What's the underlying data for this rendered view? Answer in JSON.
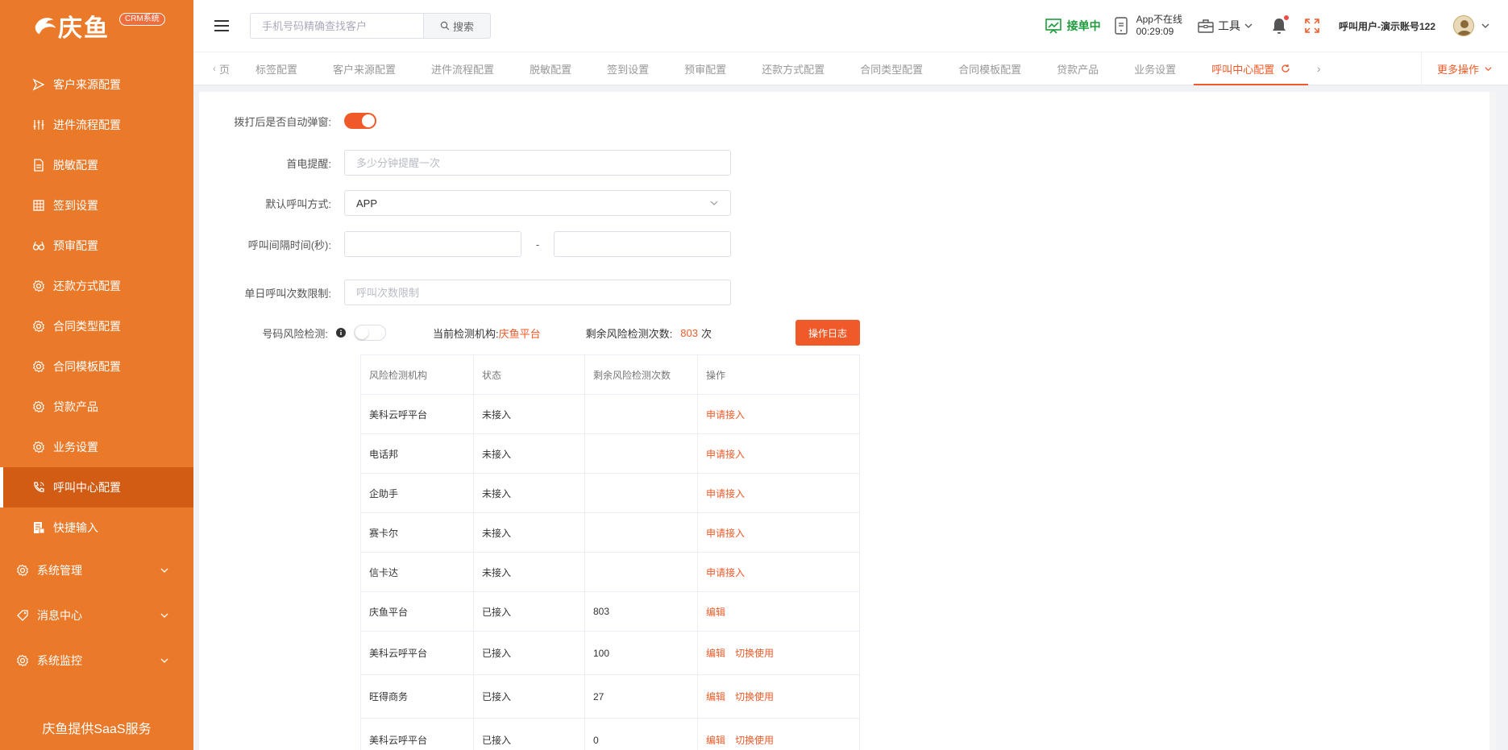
{
  "brand": {
    "logo_text": "庆鱼",
    "badge": "CRM系统",
    "footer": "庆鱼提供SaaS服务"
  },
  "sidebar": {
    "items": [
      {
        "label": "客户来源配置",
        "icon": "send-icon"
      },
      {
        "label": "进件流程配置",
        "icon": "sliders-icon"
      },
      {
        "label": "脱敏配置",
        "icon": "document-icon"
      },
      {
        "label": "签到设置",
        "icon": "calendar-grid-icon"
      },
      {
        "label": "预审配置",
        "icon": "glasses-icon"
      },
      {
        "label": "还款方式配置",
        "icon": "gear-icon"
      },
      {
        "label": "合同类型配置",
        "icon": "gear-icon"
      },
      {
        "label": "合同模板配置",
        "icon": "gear-icon"
      },
      {
        "label": "贷款产品",
        "icon": "gear-icon"
      },
      {
        "label": "业务设置",
        "icon": "gear-icon"
      },
      {
        "label": "呼叫中心配置",
        "icon": "phone-icon"
      },
      {
        "label": "快捷输入",
        "icon": "keyboard-doc-icon"
      }
    ],
    "groups": [
      {
        "label": "系统管理",
        "icon": "gear-icon"
      },
      {
        "label": "消息中心",
        "icon": "tag-icon"
      },
      {
        "label": "系统监控",
        "icon": "gear-icon"
      }
    ]
  },
  "header": {
    "search_placeholder": "手机号码精确查找客户",
    "search_button": "搜索",
    "status": "接单中",
    "app_status_line1": "App不在线",
    "app_status_line2": "00:29:09",
    "tools": "工具",
    "user": "呼叫用户-演示账号122"
  },
  "tabs": {
    "prev_label": "页",
    "items": [
      "标签配置",
      "客户来源配置",
      "进件流程配置",
      "脱敏配置",
      "签到设置",
      "预审配置",
      "还款方式配置",
      "合同类型配置",
      "合同模板配置",
      "贷款产品",
      "业务设置",
      "呼叫中心配置"
    ],
    "active_index": 11,
    "more": "更多操作"
  },
  "form": {
    "auto_popup_label": "拨打后是否自动弹窗:",
    "first_call_label": "首电提醒:",
    "first_call_placeholder": "多少分钟提醒一次",
    "default_call_label": "默认呼叫方式:",
    "default_call_value": "APP",
    "interval_label": "呼叫间隔时间(秒):",
    "interval_dash": "-",
    "daily_limit_label": "单日呼叫次数限制:",
    "daily_limit_placeholder": "呼叫次数限制",
    "risk_label": "号码风险检测:",
    "current_org_label": "当前检测机构:",
    "current_org_value": "庆鱼平台",
    "remaining_label": "剩余风险检测次数:",
    "remaining_value": "803",
    "remaining_unit": "次",
    "log_button": "操作日志"
  },
  "table": {
    "headers": [
      "风险检测机构",
      "状态",
      "剩余风险检测次数",
      "操作"
    ],
    "rows": [
      {
        "org": "美科云呼平台",
        "status": "未接入",
        "remaining": "",
        "actions": [
          "申请接入"
        ]
      },
      {
        "org": "电话邦",
        "status": "未接入",
        "remaining": "",
        "actions": [
          "申请接入"
        ]
      },
      {
        "org": "企助手",
        "status": "未接入",
        "remaining": "",
        "actions": [
          "申请接入"
        ]
      },
      {
        "org": "赛卡尔",
        "status": "未接入",
        "remaining": "",
        "actions": [
          "申请接入"
        ]
      },
      {
        "org": "信卡达",
        "status": "未接入",
        "remaining": "",
        "actions": [
          "申请接入"
        ]
      },
      {
        "org": "庆鱼平台",
        "status": "已接入",
        "remaining": "803",
        "actions": [
          "编辑"
        ]
      },
      {
        "org": "美科云呼平台",
        "status": "已接入",
        "remaining": "100",
        "actions": [
          "编辑",
          "切换使用"
        ]
      },
      {
        "org": "旺得商务",
        "status": "已接入",
        "remaining": "27",
        "actions": [
          "编辑",
          "切换使用"
        ]
      },
      {
        "org": "美科云呼平台",
        "status": "已接入",
        "remaining": "0",
        "actions": [
          "编辑",
          "切换使用"
        ]
      }
    ]
  },
  "colors": {
    "sidebar": "#ea7a2a",
    "sidebar_active": "#d35c15",
    "accent": "#f05a28",
    "online": "#1e9c3c"
  }
}
